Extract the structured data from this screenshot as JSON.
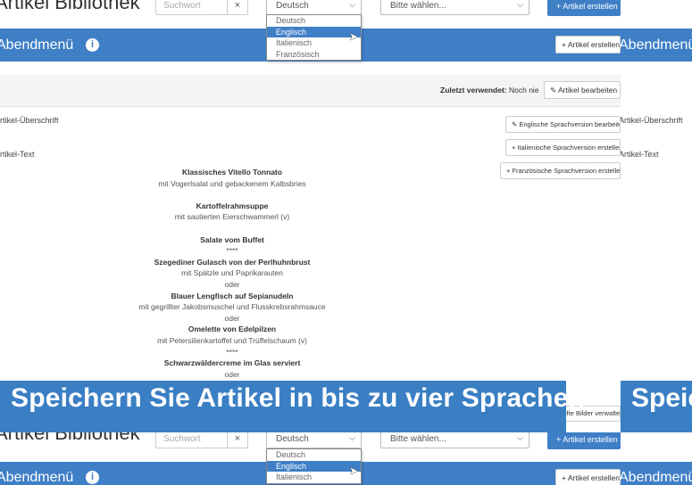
{
  "app": {
    "title": "Artikel Bibliothek"
  },
  "toolbar": {
    "search_placeholder": "Suchwort",
    "clear_symbol": "×",
    "language_value": "Deutsch",
    "category_placeholder": "Bitte wählen...",
    "create_label": "+ Artikel erstellen"
  },
  "dropdown": {
    "options": [
      "Deutsch",
      "Englisch",
      "Italienisch",
      "Französisch"
    ],
    "highlighted": "Englisch"
  },
  "panel": {
    "title": "Abendmenü",
    "info_symbol": "i",
    "create_label": "+ Artikel erstellen"
  },
  "infobar": {
    "last_used_label": "Zuletzt verwendet:",
    "last_used_value": "Noch nie",
    "edit_label": "✎ Artikel bearbeiten"
  },
  "fields": {
    "heading_label": "Artikel-Überschrift",
    "text_label": "Artikel-Text"
  },
  "language_buttons": {
    "english": "✎ Englische Sprachversion bearbeiten",
    "italian": "+ Italienische Sprachversion erstellen",
    "french": "+ Französische Sprachversion erstellen"
  },
  "menu_lines": [
    {
      "text": "Klassisches Vitello Tonnato",
      "bold": true
    },
    {
      "text": "mit Vogerlsalat und gebackenem Kalbsbries",
      "bold": false
    },
    {
      "text": "",
      "bold": false
    },
    {
      "text": "Kartoffelrahmsuppe",
      "bold": true
    },
    {
      "text": "mit sautierten Eierschwammerl (v)",
      "bold": false
    },
    {
      "text": "",
      "bold": false
    },
    {
      "text": "Salate vom Buffet",
      "bold": true
    },
    {
      "text": "****",
      "bold": false
    },
    {
      "text": "Szegediner Gulasch von der Perlhuhnbrust",
      "bold": true
    },
    {
      "text": "mit Spätzle und Paprikarauten",
      "bold": false
    },
    {
      "text": "oder",
      "bold": false
    },
    {
      "text": "Blauer Lengfisch auf Sepianudeln",
      "bold": true
    },
    {
      "text": "mit gegrillter Jakobsmuschel und Flusskrebsrahmsauce",
      "bold": false
    },
    {
      "text": "oder",
      "bold": false
    },
    {
      "text": "Omelette von Edelpilzen",
      "bold": true
    },
    {
      "text": "mit Petersilienkartoffel und Trüffelschaum (v)",
      "bold": false
    },
    {
      "text": "****",
      "bold": false
    },
    {
      "text": "Schwarzwäldercreme im Glas serviert",
      "bold": true
    },
    {
      "text": "oder",
      "bold": false
    }
  ],
  "hidden_button": {
    "label": "Verknüpfte Bilder verwalten"
  },
  "caption": {
    "text": "Speichern Sie Artikel in bis zu vier Sprachen",
    "right_fragment": "Speic"
  },
  "colors": {
    "primary": "#3f7fc6",
    "caption_bg": "#3a7fc4",
    "dropdown_selected": "#3f7fc6"
  }
}
